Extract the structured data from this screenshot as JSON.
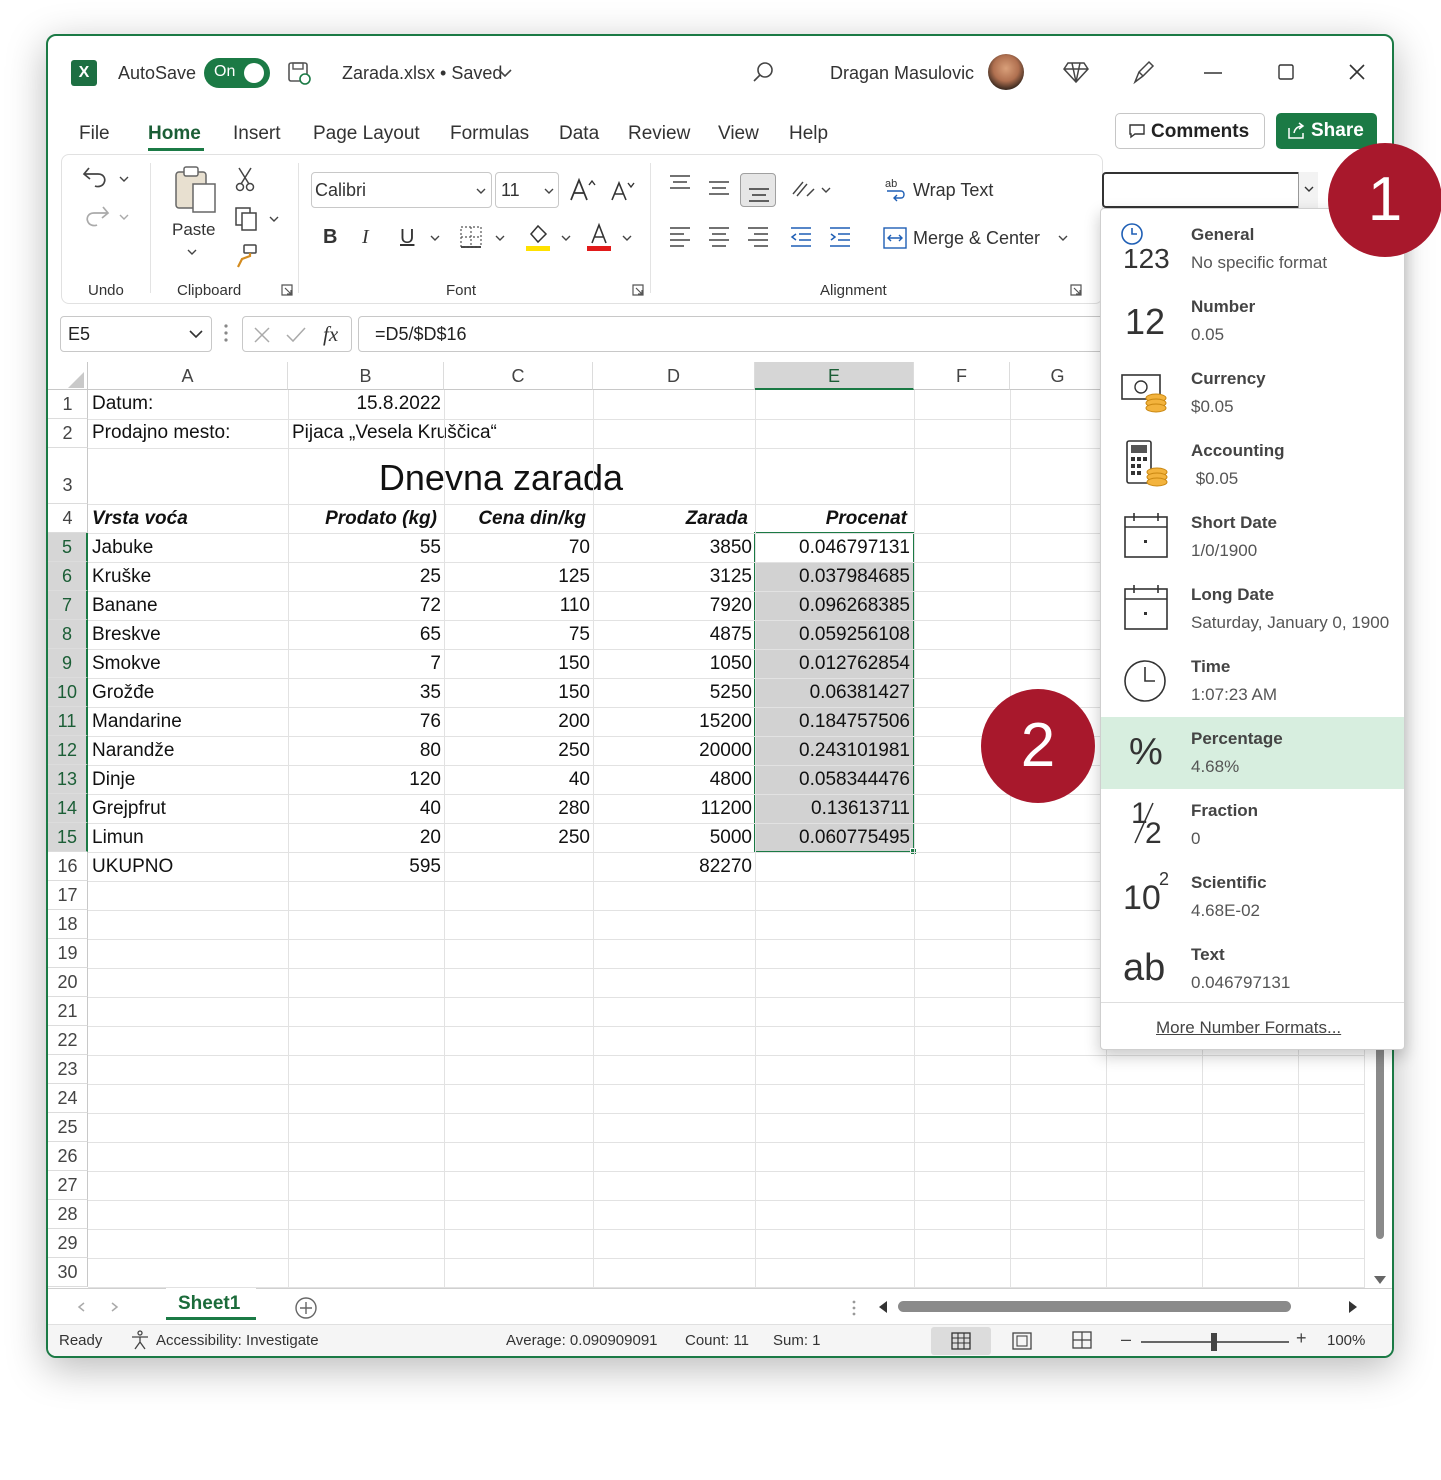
{
  "titlebar": {
    "autosave_label": "AutoSave",
    "toggle_label": "On",
    "file_title": "Zarada.xlsx • Saved",
    "user_name": "Dragan Masulovic"
  },
  "menu_tabs": [
    "File",
    "Home",
    "Insert",
    "Page Layout",
    "Formulas",
    "Data",
    "Review",
    "View",
    "Help"
  ],
  "buttons": {
    "comments": "Comments",
    "share": "Share"
  },
  "ribbon": {
    "groups": {
      "undo": "Undo",
      "clipboard": "Clipboard",
      "font": "Font",
      "alignment": "Alignment"
    },
    "paste_label": "Paste",
    "font_name": "Calibri",
    "font_size": "11",
    "bold": "B",
    "italic": "I",
    "underline": "U",
    "wrap_text": "Wrap Text",
    "merge_center": "Merge & Center",
    "number_format_value": ""
  },
  "formula_bar": {
    "name_box": "E5",
    "fx": "fx",
    "formula": "=D5/$D$16"
  },
  "columns": [
    "A",
    "B",
    "C",
    "D",
    "E",
    "F",
    "G"
  ],
  "row_numbers": [
    "1",
    "2",
    "3",
    "4",
    "5",
    "6",
    "7",
    "8",
    "9",
    "10",
    "11",
    "12",
    "13",
    "14",
    "15",
    "16",
    "17",
    "18",
    "19",
    "20",
    "21",
    "22",
    "23",
    "24",
    "25",
    "26",
    "27",
    "28",
    "29",
    "30"
  ],
  "sheet": {
    "datum_label": "Datum:",
    "datum_value": "15.8.2022",
    "mesto_label": "Prodajno mesto:",
    "mesto_value": "Pijaca „Vesela Kruščica“",
    "title": "Dnevna zarada",
    "headers": [
      "Vrsta voća",
      "Prodato (kg)",
      "Cena din/kg",
      "Zarada",
      "Procenat"
    ],
    "rows": [
      [
        "Jabuke",
        "55",
        "70",
        "3850",
        "0.046797131"
      ],
      [
        "Kruške",
        "25",
        "125",
        "3125",
        "0.037984685"
      ],
      [
        "Banane",
        "72",
        "110",
        "7920",
        "0.096268385"
      ],
      [
        "Breskve",
        "65",
        "75",
        "4875",
        "0.059256108"
      ],
      [
        "Smokve",
        "7",
        "150",
        "1050",
        "0.012762854"
      ],
      [
        "Grožđe",
        "35",
        "150",
        "5250",
        "0.06381427"
      ],
      [
        "Mandarine",
        "76",
        "200",
        "15200",
        "0.184757506"
      ],
      [
        "Narandže",
        "80",
        "250",
        "20000",
        "0.243101981"
      ],
      [
        "Dinje",
        "120",
        "40",
        "4800",
        "0.058344476"
      ],
      [
        "Grejpfrut",
        "40",
        "280",
        "11200",
        "0.13613711"
      ],
      [
        "Limun",
        "20",
        "250",
        "5000",
        "0.060775495"
      ]
    ],
    "total": [
      "UKUPNO",
      "595",
      "",
      "82270",
      ""
    ]
  },
  "number_formats": [
    {
      "name": "General",
      "example": "No specific format",
      "icon": "general-123-icon"
    },
    {
      "name": "Number",
      "example": "0.05",
      "icon": "number-12-icon"
    },
    {
      "name": "Currency",
      "example": "$0.05",
      "icon": "currency-icon"
    },
    {
      "name": "Accounting",
      "example": " $0.05",
      "icon": "accounting-icon"
    },
    {
      "name": "Short Date",
      "example": "1/0/1900",
      "icon": "calendar-icon"
    },
    {
      "name": "Long Date",
      "example": "Saturday, January 0, 1900",
      "icon": "calendar-icon"
    },
    {
      "name": "Time",
      "example": "1:07:23 AM",
      "icon": "clock-icon"
    },
    {
      "name": "Percentage",
      "example": "4.68%",
      "icon": "percent-icon"
    },
    {
      "name": "Fraction",
      "example": "0",
      "icon": "fraction-icon"
    },
    {
      "name": "Scientific",
      "example": "4.68E-02",
      "icon": "scientific-icon"
    },
    {
      "name": "Text",
      "example": "0.046797131",
      "icon": "text-ab-icon"
    }
  ],
  "more_formats": "More Number Formats...",
  "icon_texts": {
    "num": "12",
    "pct": "%",
    "ab": "ab",
    "sci_base": "10",
    "sci_exp": "2",
    "gen_num": "123",
    "frac_n": "1",
    "frac_d": "2"
  },
  "sheet_tab": "Sheet1",
  "status": {
    "ready": "Ready",
    "accessibility": "Accessibility: Investigate",
    "average": "Average: 0.090909091",
    "count": "Count: 11",
    "sum": "Sum: 1",
    "zoom": "100%"
  },
  "callouts": [
    "1",
    "2"
  ],
  "colors": {
    "accent": "#1b7a45",
    "callout": "#a8182c",
    "selected_fill": "#d2d2d2",
    "highlight": "#d7eedf"
  }
}
